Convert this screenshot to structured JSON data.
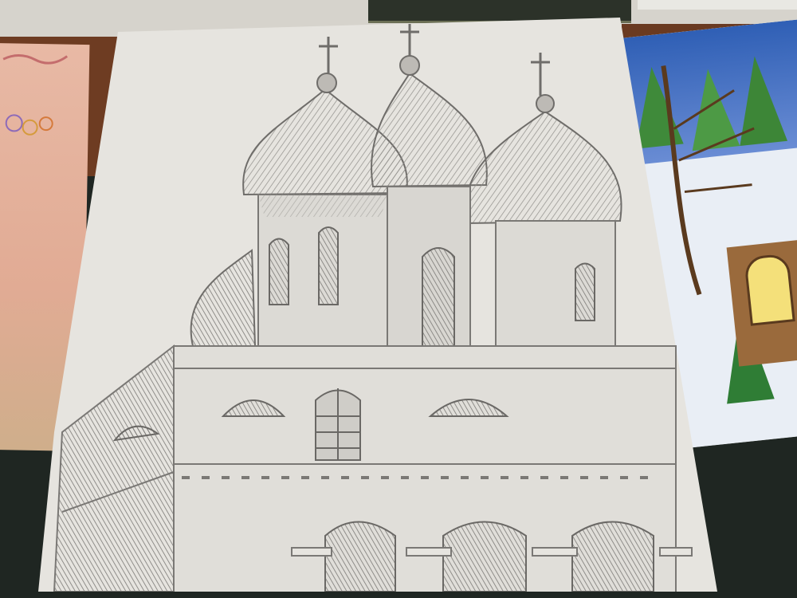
{
  "scene": {
    "subject": "pencil-drawing-of-orthodox-church-with-onion-domes",
    "colors": {
      "background": "#1f2622",
      "paper": "#e6e4df",
      "pencil": "#8a8886",
      "shade": "#6f6e6c",
      "wood": "#6e3c22",
      "sky": "#3466b8",
      "pine": "#3f8a3a",
      "house": "#9a6a3c",
      "window": "#f4e07a"
    },
    "icons": [
      "cross-icon",
      "onion-dome-icon",
      "arched-window-icon"
    ]
  }
}
